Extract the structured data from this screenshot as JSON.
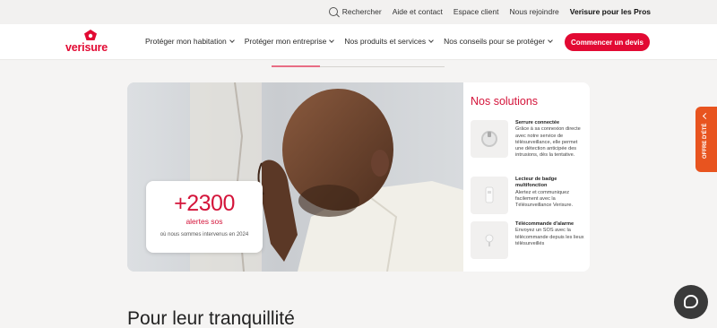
{
  "utility_bar": {
    "search_label": "Rechercher",
    "help_label": "Aide et contact",
    "client_label": "Espace client",
    "join_label": "Nous rejoindre",
    "pros_label": "Verisure pour les Pros"
  },
  "nav": {
    "logo_text": "verisure",
    "items": [
      {
        "label": "Protéger mon habitation"
      },
      {
        "label": "Protéger mon entreprise"
      },
      {
        "label": "Nos produits et services"
      },
      {
        "label": "Nos conseils pour se protéger"
      }
    ],
    "cta_label": "Commencer un devis"
  },
  "progress": {
    "active_fraction": 0.28
  },
  "hero": {
    "stat_number": "+2300",
    "stat_label": "alertes sos",
    "stat_sub": "où nous sommes intervenus en 2024"
  },
  "solutions": {
    "title": "Nos solutions",
    "items": [
      {
        "title": "Serrure connectée",
        "desc": "Grâce à sa connexion directe avec notre service de télésurveillance, elle permet une détection anticipée des intrusions, dès la tentative.",
        "icon": "smart-lock-icon"
      },
      {
        "title": "Lecteur de badge multifonction",
        "desc": "Alertez et communiquez facilement avec la Télésurveillance Verisure.",
        "icon": "badge-reader-icon"
      },
      {
        "title": "Télécommande d'alarme",
        "desc": "Envoyez un SOS avec la télécommande depuis les lieux télésurveillés",
        "icon": "remote-control-icon"
      }
    ]
  },
  "section_heading": "Pour leur tranquillité",
  "side_tab": {
    "label": "OFFRE D'ÉTÉ"
  },
  "colors": {
    "brand_red": "#e20a33",
    "offer_orange": "#e8541f"
  }
}
